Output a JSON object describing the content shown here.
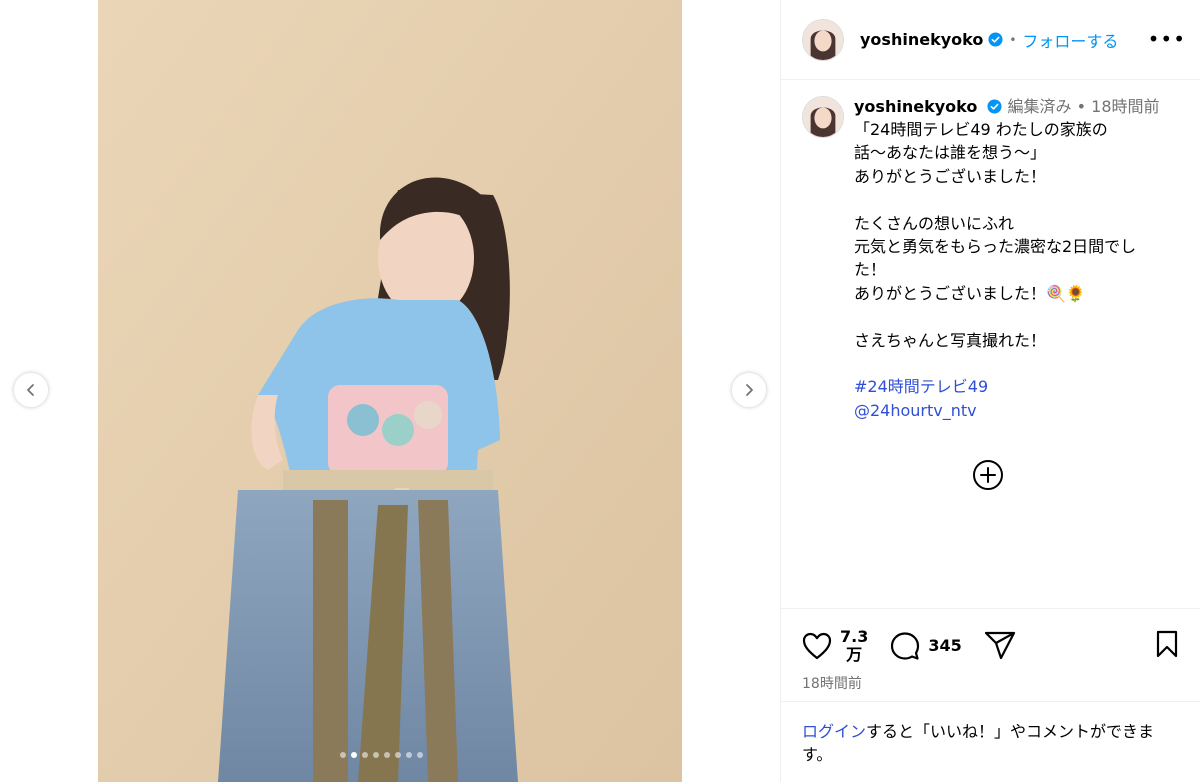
{
  "post": {
    "username": "yoshinekyoko",
    "follow_label": "フォローする",
    "more_label": "•••",
    "dot_separator": "•",
    "caption": {
      "username": "yoshinekyoko",
      "edited_label": "編集済み",
      "separator": "•",
      "time": "18時間前",
      "text": "「24時間テレビ49 わたしの家族の\n話〜あなたは誰を想う〜」\nありがとうございました！\n\nたくさんの想いにふれ\n元気と勇気をもらった濃密な2日間でし\nた！\nありがとうございました！🍭🌻\n\nさえちゃんと写真撮れた！",
      "hashtag": "#24時間テレビ49",
      "mention": "@24hourtv_ntv"
    },
    "likes": "7.3\n万",
    "comments": "345",
    "timestamp": "18時間前"
  },
  "login": {
    "link": "ログイン",
    "rest": "すると「いいね！」やコメントができます。"
  },
  "carousel": {
    "dot_count": 8,
    "active_dot": 1
  },
  "icons": {
    "prev": "chevron-left-icon",
    "next": "chevron-right-icon",
    "verified": "verified-badge-icon",
    "like": "heart-icon",
    "comment": "comment-icon",
    "share": "share-icon",
    "save": "bookmark-icon",
    "more_comments": "plus-circle-icon"
  },
  "colors": {
    "link": "#2e4fd6",
    "follow": "#0095f6",
    "muted": "#737373",
    "verified": "#0095f6"
  }
}
